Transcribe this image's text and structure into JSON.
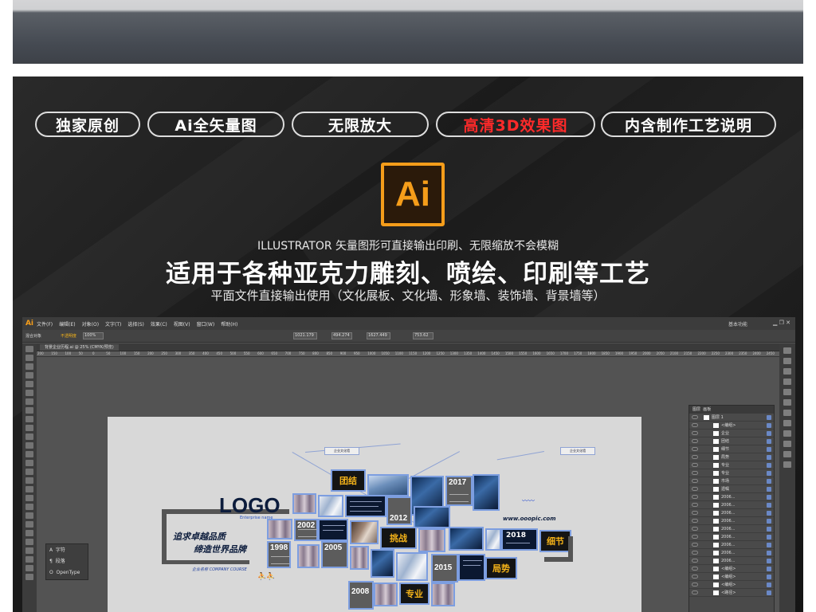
{
  "badges": [
    "独家原创",
    "Ai全矢量图",
    "无限放大",
    "高清3D效果图",
    "内含制作工艺说明"
  ],
  "badge_highlight_index": 3,
  "badge_highlight_color": "#ff2a2a",
  "ai_logo_text": "Ai",
  "ai_logo_color": "#f59d1a",
  "headline": {
    "line1": "ILLUSTRATOR 矢量图形可直接输出印刷、无限缩放不会模糊",
    "line2": "适用于各种亚克力雕刻、喷绘、印刷等工艺",
    "line3": "平面文件直接输出使用（文化展板、文化墙、形象墙、装饰墙、背景墙等）"
  },
  "ai_app": {
    "badge": "Ai",
    "menus": [
      "文件(F)",
      "编辑(E)",
      "对象(O)",
      "文字(T)",
      "选择(S)",
      "效果(C)",
      "视图(V)",
      "窗口(W)",
      "帮助(H)"
    ],
    "workspace": "基本功能",
    "controls": {
      "object": "混合对象",
      "opacity_label": "不透明度",
      "opacity": "100%",
      "x": "1021.179",
      "y": "494.274",
      "w": "1627.449",
      "h": "753.62"
    },
    "doc_tab": "背景企业历程.ai @ 25% (CMYK/预览)",
    "ruler_ticks": [
      "200",
      "150",
      "100",
      "50",
      "0",
      "50",
      "100",
      "150",
      "200",
      "250",
      "300",
      "350",
      "400",
      "450",
      "500",
      "550",
      "600",
      "650",
      "700",
      "750",
      "800",
      "850",
      "900",
      "950",
      "1000",
      "1050",
      "1100",
      "1150",
      "1200",
      "1250",
      "1300",
      "1350",
      "1400",
      "1450",
      "1500",
      "1550",
      "1600",
      "1650",
      "1700",
      "1750",
      "1800",
      "1850",
      "1900",
      "1950",
      "2000",
      "2050",
      "2100",
      "2150",
      "2200",
      "2250",
      "2300",
      "2350",
      "2400",
      "2450"
    ],
    "char_panel": [
      "字符",
      "段落",
      "OpenType"
    ],
    "layers_panel": {
      "tabs": [
        "图层",
        "画板"
      ],
      "top_layer": "图层 1",
      "rows": [
        "<编组>",
        "企业",
        "团结",
        "细节",
        "局势",
        "专业",
        "专业",
        "市场",
        "遗嘱",
        "2006...",
        "2006...",
        "2006...",
        "2006...",
        "2006...",
        "2006...",
        "2006...",
        "2006...",
        "2006...",
        "<编组>",
        "<编组>",
        "<编组>",
        "<路径>"
      ]
    }
  },
  "artwork": {
    "logo": "LOGO",
    "logo_sub": "Enterprise name",
    "slogan1": "追求卓越品质",
    "slogan2": "缔造世界品牌",
    "company": "企业名称 COMPANY COURSE",
    "website": "www.ooopic.com",
    "years": [
      "1998",
      "2002",
      "2005",
      "2008",
      "2012",
      "2015",
      "2017",
      "2018"
    ],
    "keywords": [
      "团结",
      "挑战",
      "专业",
      "局势",
      "细节"
    ],
    "small_label": "企业文化墙"
  }
}
